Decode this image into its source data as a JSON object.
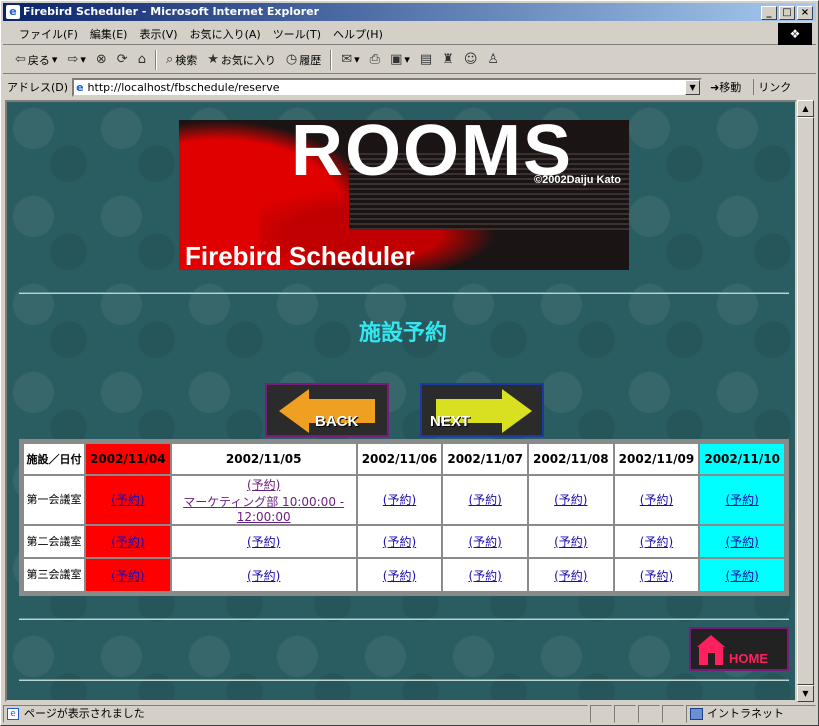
{
  "window": {
    "title": "Firebird Scheduler - Microsoft Internet Explorer"
  },
  "menu": [
    "ファイル(F)",
    "編集(E)",
    "表示(V)",
    "お気に入り(A)",
    "ツール(T)",
    "ヘルプ(H)"
  ],
  "toolbar": {
    "back": "戻る",
    "search": "検索",
    "favorites": "お気に入り",
    "history": "履歴"
  },
  "address": {
    "label": "アドレス(D)",
    "url": "http://localhost/fbschedule/reserve",
    "go": "移動",
    "links": "リンク"
  },
  "banner": {
    "title": "ROOMS",
    "copyright": "©2002Daiju Kato",
    "subtitle": "Firebird Scheduler"
  },
  "page": {
    "heading": "施設予約",
    "back_label": "BACK",
    "next_label": "NEXT",
    "home_label": "HOME"
  },
  "table": {
    "corner": "施設／日付",
    "dates": [
      "2002/11/04",
      "2002/11/05",
      "2002/11/06",
      "2002/11/07",
      "2002/11/08",
      "2002/11/09",
      "2002/11/10"
    ],
    "rows": [
      {
        "room": "第一会議室",
        "cells": [
          "(予約)",
          "(予約)",
          "(予約)",
          "(予約)",
          "(予約)",
          "(予約)",
          "(予約)"
        ],
        "booking": "マーケティング部 10:00:00 - 12:00:00"
      },
      {
        "room": "第二会議室",
        "cells": [
          "(予約)",
          "(予約)",
          "(予約)",
          "(予約)",
          "(予約)",
          "(予約)",
          "(予約)"
        ]
      },
      {
        "room": "第三会議室",
        "cells": [
          "(予約)",
          "(予約)",
          "(予約)",
          "(予約)",
          "(予約)",
          "(予約)",
          "(予約)"
        ]
      }
    ]
  },
  "status": {
    "text": "ページが表示されました",
    "zone": "イントラネット"
  },
  "colors": {
    "holiday_red": "#ff0000",
    "weekend_cyan": "#00ffff",
    "background": "#2a5d62",
    "heading": "#33e6f0"
  }
}
